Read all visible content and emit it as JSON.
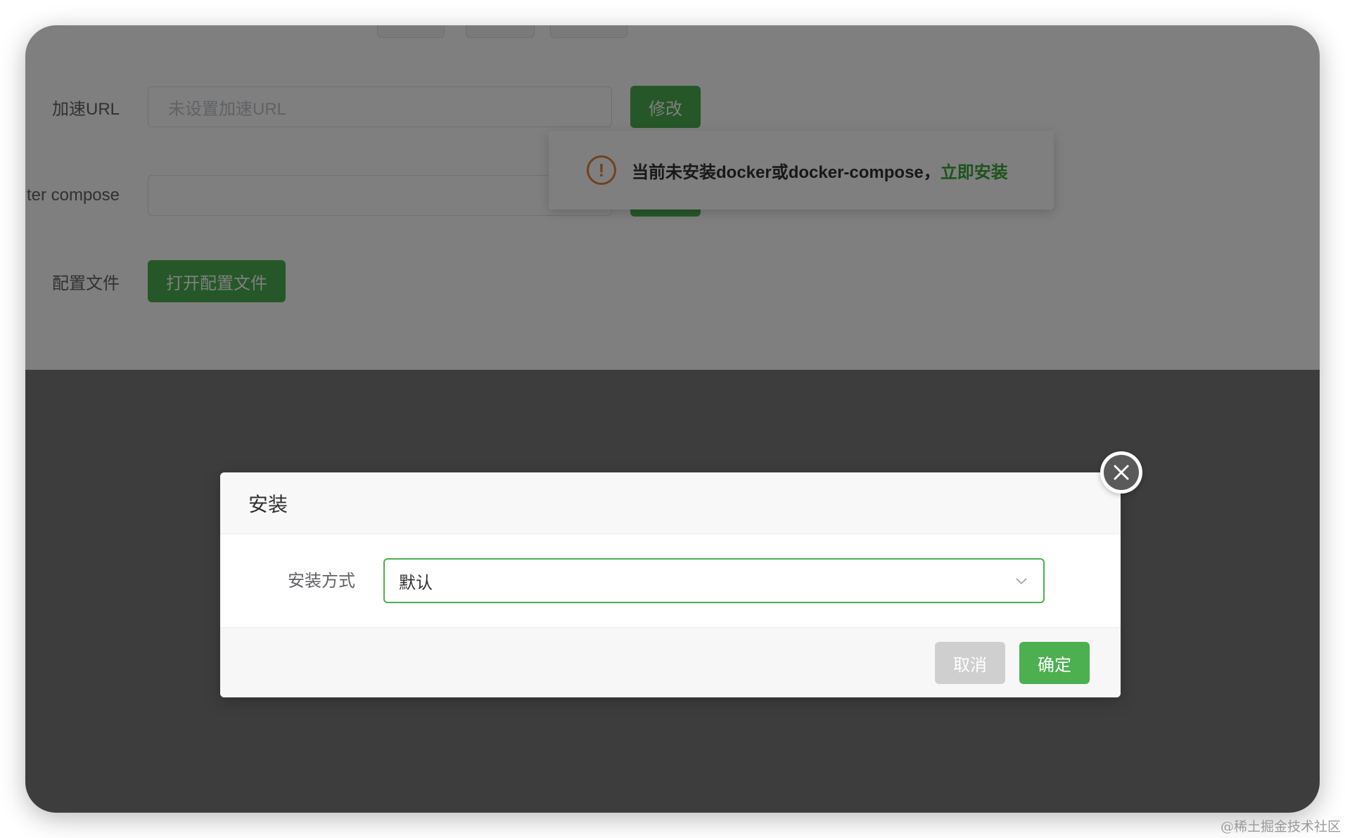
{
  "background": {
    "top_tabs": [
      "",
      "",
      "",
      ""
    ],
    "rows": [
      {
        "label": "加速URL",
        "placeholder": "未设置加速URL",
        "button": "修改"
      },
      {
        "label": "ter compose",
        "placeholder": "",
        "button": ""
      },
      {
        "label": "配置文件",
        "button": "打开配置文件"
      }
    ]
  },
  "banner": {
    "message": "当前未安装docker或docker-compose，",
    "link": "立即安装",
    "icon": "warning-circle-icon",
    "accent": "#e6823a"
  },
  "modal": {
    "title": "安装",
    "field_label": "安装方式",
    "select_value": "默认",
    "cancel_label": "取消",
    "confirm_label": "确定"
  },
  "colors": {
    "primary": "#4caf50",
    "link": "#3aa63a",
    "warning": "#e6823a"
  },
  "watermark": "@稀土掘金技术社区"
}
